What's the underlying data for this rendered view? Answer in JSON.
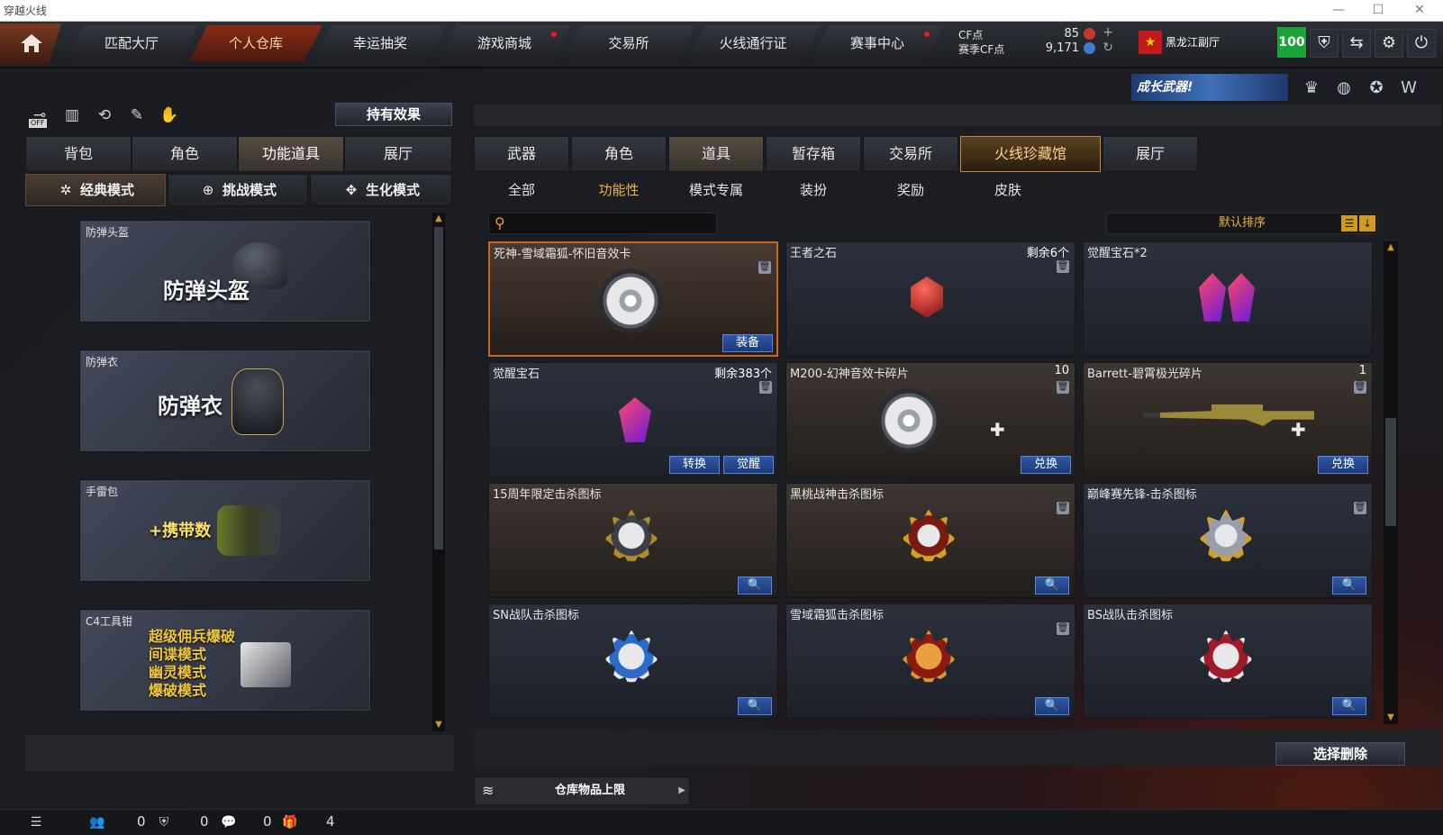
{
  "window": {
    "title": "穿越火线",
    "minimize": "—",
    "maximize": "☐",
    "close": "✕"
  },
  "topnav": {
    "tabs": [
      {
        "label": "匹配大厅",
        "dot": false
      },
      {
        "label": "个人仓库",
        "dot": false,
        "active": true
      },
      {
        "label": "幸运抽奖",
        "dot": false
      },
      {
        "label": "游戏商城",
        "dot": true
      },
      {
        "label": "交易所",
        "dot": false
      },
      {
        "label": "火线通行证",
        "dot": false
      },
      {
        "label": "赛事中心",
        "dot": true
      }
    ],
    "cf_label": "CF点",
    "season_cf_label": "赛季CF点",
    "cf_value": "85",
    "season_cf_value": "9,171",
    "room": "黑龙江副厅",
    "level": "100",
    "flag_star": "★",
    "icons": [
      "shield-icon",
      "switch-icon",
      "gear-icon",
      "power-icon"
    ]
  },
  "left": {
    "icons": [
      "off-toggle-icon",
      "ranking-icon",
      "history-icon",
      "spray-icon",
      "glove-icon"
    ],
    "off_label": "OFF",
    "effects_button": "持有效果",
    "tabs": [
      {
        "label": "背包"
      },
      {
        "label": "角色"
      },
      {
        "label": "功能道具",
        "active": true
      },
      {
        "label": "展厅"
      }
    ],
    "modes": [
      {
        "label": "经典模式",
        "icon": "✲",
        "active": true
      },
      {
        "label": "挑战模式",
        "icon": "⊕"
      },
      {
        "label": "生化模式",
        "icon": "✥"
      }
    ],
    "items": [
      {
        "name": "防弹头盔",
        "art": "防弹头盔"
      },
      {
        "name": "防弹衣",
        "art": "防弹衣"
      },
      {
        "name": "手雷包",
        "art": "+携带数"
      },
      {
        "name": "C4工具钳",
        "lines": [
          "超级佣兵爆破",
          "间谍模式",
          "幽灵模式",
          "爆破模式"
        ]
      }
    ]
  },
  "right": {
    "banner": "成长武器!",
    "tabs": [
      {
        "label": "武器"
      },
      {
        "label": "角色"
      },
      {
        "label": "道具",
        "active": true
      },
      {
        "label": "暂存箱"
      },
      {
        "label": "交易所"
      },
      {
        "label": "火线珍藏馆",
        "highlight": true
      },
      {
        "label": "展厅"
      }
    ],
    "subtabs": [
      {
        "label": "全部"
      },
      {
        "label": "功能性",
        "active": true
      },
      {
        "label": "模式专属"
      },
      {
        "label": "装扮"
      },
      {
        "label": "奖励"
      },
      {
        "label": "皮肤"
      }
    ],
    "search_placeholder": "",
    "sort_label": "默认排序",
    "items": [
      {
        "name": "死神-雪域霜狐-怀旧音效卡",
        "count": "",
        "buttons": [
          "装备"
        ],
        "icon": "disc",
        "selected": true,
        "trash": true
      },
      {
        "name": "王者之石",
        "count": "剩余6个",
        "buttons": [],
        "icon": "red-stone",
        "trash": true
      },
      {
        "name": "觉醒宝石*2",
        "count": "",
        "buttons": [],
        "icon": "gem-pair",
        "trash": false
      },
      {
        "name": "觉醒宝石",
        "count": "剩余383个",
        "buttons": [
          "转换",
          "觉醒"
        ],
        "icon": "gem",
        "trash": true
      },
      {
        "name": "M200-幻神音效卡碎片",
        "count": "10",
        "buttons": [
          "兑换"
        ],
        "icon": "disc-fragment",
        "trash": true
      },
      {
        "name": "Barrett-碧霄极光碎片",
        "count": "1",
        "buttons": [
          "兑换"
        ],
        "icon": "rifle-fragment",
        "trash": true
      },
      {
        "name": "15周年限定击杀图标",
        "count": "",
        "buttons": [],
        "icon": "kill-badge",
        "trash": false,
        "magnify": true
      },
      {
        "name": "黑桃战神击杀图标",
        "count": "",
        "buttons": [],
        "icon": "kill-badge",
        "trash": true,
        "magnify": true
      },
      {
        "name": "巅峰赛先锋-击杀图标",
        "count": "",
        "buttons": [],
        "icon": "kill-badge",
        "trash": true,
        "magnify": true
      },
      {
        "name": "SN战队击杀图标",
        "count": "",
        "buttons": [],
        "icon": "kill-badge",
        "trash": false,
        "magnify": true
      },
      {
        "name": "雪域霜狐击杀图标",
        "count": "",
        "buttons": [],
        "icon": "kill-badge",
        "trash": true,
        "magnify": true
      },
      {
        "name": "BS战队击杀图标",
        "count": "",
        "buttons": [],
        "icon": "kill-badge",
        "trash": false,
        "magnify": true
      }
    ],
    "delete_button": "选择删除",
    "capacity_label": "仓库物品上限"
  },
  "status": {
    "counts": [
      "0",
      "0",
      "0",
      "4"
    ]
  }
}
